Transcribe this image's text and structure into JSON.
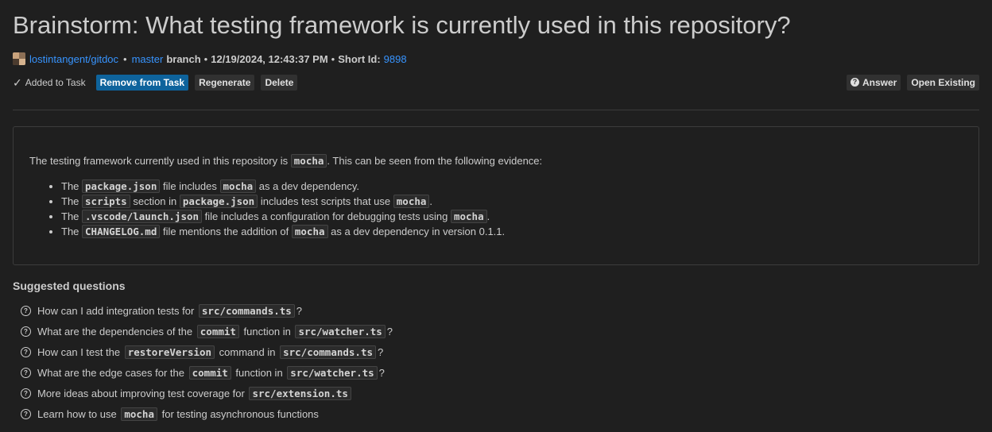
{
  "header": {
    "title": "Brainstorm: What testing framework is currently used in this repository?",
    "repo": "lostintangent/gitdoc",
    "sep1": "•",
    "branch_name": "master",
    "branch_word": "branch",
    "sep2": "•",
    "timestamp": "12/19/2024, 12:43:37 PM",
    "sep3": "•",
    "short_id_label": "Short Id:",
    "short_id": "9898"
  },
  "toolbar": {
    "added_label": "Added to Task",
    "remove_label": "Remove from Task",
    "regenerate_label": "Regenerate",
    "delete_label": "Delete",
    "answer_label": "Answer",
    "open_existing_label": "Open Existing"
  },
  "answer": {
    "intro_pre": "The testing framework currently used in this repository is",
    "intro_code": "mocha",
    "intro_post": ". This can be seen from the following evidence:",
    "items": [
      {
        "t1": "The",
        "c1": "package.json",
        "t2": "file includes",
        "c2": "mocha",
        "t3": "as a dev dependency.",
        "c3": "",
        "t4": ""
      },
      {
        "t1": "The",
        "c1": "scripts",
        "t2": "section in",
        "c2": "package.json",
        "t3": "includes test scripts that use",
        "c3": "mocha",
        "t4": "."
      },
      {
        "t1": "The",
        "c1": ".vscode/launch.json",
        "t2": "file includes a configuration for debugging tests using",
        "c2": "mocha",
        "t3": ".",
        "c3": "",
        "t4": ""
      },
      {
        "t1": "The",
        "c1": "CHANGELOG.md",
        "t2": "file mentions the addition of",
        "c2": "mocha",
        "t3": "as a dev dependency in version 0.1.1.",
        "c3": "",
        "t4": ""
      }
    ]
  },
  "suggested": {
    "title": "Suggested questions",
    "items": [
      {
        "pre": "How can I add integration tests for",
        "code": "src/commands.ts",
        "mid": "",
        "code2": "",
        "post": "?"
      },
      {
        "pre": "What are the dependencies of the",
        "code": "commit",
        "mid": "function in",
        "code2": "src/watcher.ts",
        "post": "?"
      },
      {
        "pre": "How can I test the",
        "code": "restoreVersion",
        "mid": "command in",
        "code2": "src/commands.ts",
        "post": "?"
      },
      {
        "pre": "What are the edge cases for the",
        "code": "commit",
        "mid": "function in",
        "code2": "src/watcher.ts",
        "post": "?"
      },
      {
        "pre": "More ideas about improving test coverage for",
        "code": "src/extension.ts",
        "mid": "",
        "code2": "",
        "post": ""
      },
      {
        "pre": "Learn how to use",
        "code": "mocha",
        "mid": "for testing asynchronous functions",
        "code2": "",
        "post": ""
      }
    ]
  },
  "icons": {
    "check": "check-icon",
    "question": "question-circle-icon",
    "avatar": "avatar"
  },
  "colors": {
    "background": "#1f1f1f",
    "link": "#3794ff",
    "primary_button": "#0e639c",
    "button": "#313131"
  }
}
